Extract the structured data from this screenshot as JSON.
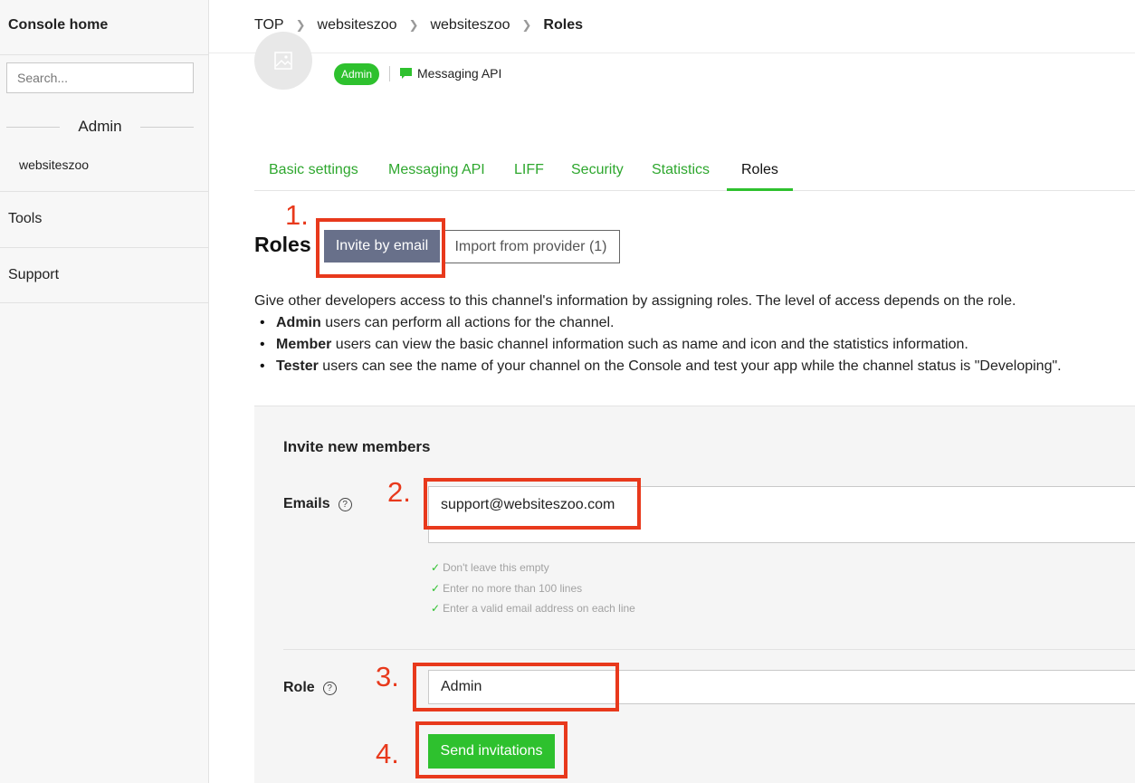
{
  "sidebar": {
    "console_home": "Console home",
    "search_placeholder": "Search...",
    "admin_heading": "Admin",
    "provider": "websiteszoo",
    "sections": [
      "Tools",
      "Support"
    ]
  },
  "breadcrumb": [
    "TOP",
    "websiteszoo",
    "websiteszoo",
    "Roles"
  ],
  "channel": {
    "role_badge": "Admin",
    "type_label": "Messaging API"
  },
  "tabs": [
    {
      "label": "Basic settings",
      "active": false
    },
    {
      "label": "Messaging API",
      "active": false
    },
    {
      "label": "LIFF",
      "active": false
    },
    {
      "label": "Security",
      "active": false
    },
    {
      "label": "Statistics",
      "active": false
    },
    {
      "label": "Roles",
      "active": true
    }
  ],
  "roles": {
    "title": "Roles",
    "invite_by_email": "Invite by email",
    "import_from_provider": "Import from provider (1)",
    "intro": "Give other developers access to this channel's information by assigning roles. The level of access depends on the role.",
    "bullets": [
      {
        "role": "Admin",
        "text": " users can perform all actions for the channel."
      },
      {
        "role": "Member",
        "text": " users can view the basic channel information such as name and icon and the statistics information."
      },
      {
        "role": "Tester",
        "text": " users can see the name of your channel on the Console and test your app while the channel status is \"Developing\"."
      }
    ]
  },
  "invite": {
    "title": "Invite new members",
    "emails_label": "Emails",
    "emails_value": "support@websiteszoo.com",
    "rules": [
      "Don't leave this empty",
      "Enter no more than 100 lines",
      "Enter a valid email address on each line"
    ],
    "role_label": "Role",
    "role_value": "Admin",
    "send_label": "Send invitations"
  },
  "annotations": [
    "1.",
    "2.",
    "3.",
    "4."
  ],
  "colors": {
    "accent_green": "#2ec12e",
    "annotation_red": "#e8391c",
    "invite_button": "#68708a"
  }
}
